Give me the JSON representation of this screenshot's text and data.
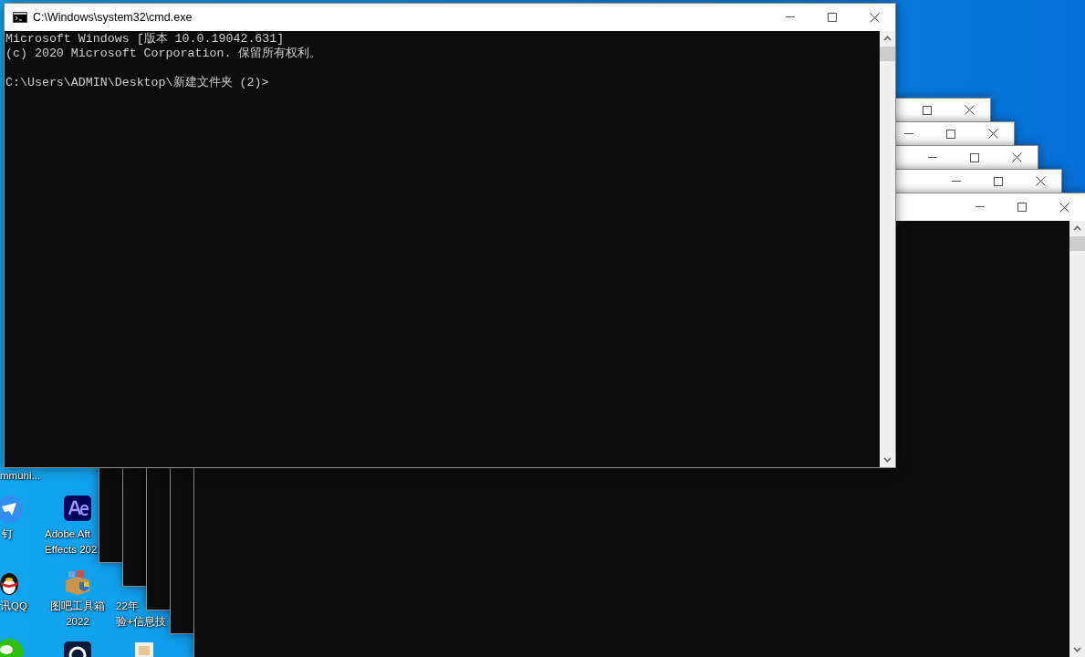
{
  "desktop_icons": [
    {
      "labels": [
        "mmuni..."
      ]
    },
    {
      "kind": "dingtalk",
      "labels": [
        "钉"
      ]
    },
    {
      "kind": "after-effects",
      "labels": [
        "Adobe Aft",
        "Effects 202"
      ]
    },
    {
      "kind": "qq",
      "labels": [
        "讯QQ"
      ]
    },
    {
      "kind": "toolbox",
      "labels": [
        "图吧工具箱",
        "2022"
      ]
    },
    {
      "labels": [
        "22年",
        "验+信息技"
      ]
    },
    {
      "kind": "wechat"
    },
    {
      "kind": "ring-app"
    },
    {
      "kind": "file"
    }
  ],
  "background_windows": [
    {
      "kind": "console"
    },
    {
      "kind": "console"
    },
    {
      "kind": "console"
    },
    {
      "kind": "console"
    },
    {
      "kind": "console"
    }
  ],
  "cmd_window": {
    "title": "C:\\Windows\\system32\\cmd.exe",
    "output": [
      "Microsoft Windows [版本 10.0.19042.631]",
      "(c) 2020 Microsoft Corporation. 保留所有权利。"
    ],
    "prompt": "C:\\Users\\ADMIN\\Desktop\\新建文件夹 (2)>"
  }
}
